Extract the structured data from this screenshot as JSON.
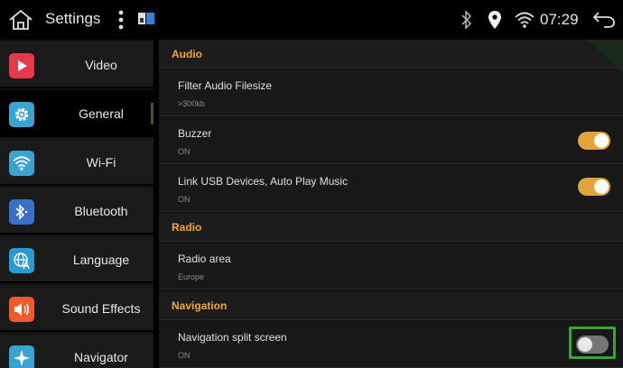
{
  "statusbar": {
    "title": "Settings",
    "time": "07:29"
  },
  "sidebar": {
    "items": [
      {
        "label": "Video",
        "icon": "video-icon",
        "color": "#e8384c",
        "active": false
      },
      {
        "label": "General",
        "icon": "gear-icon",
        "color": "#3aa3d0",
        "active": true
      },
      {
        "label": "Wi-Fi",
        "icon": "wifi-icon",
        "color": "#3aa3d0",
        "active": false
      },
      {
        "label": "Bluetooth",
        "icon": "bluetooth-icon",
        "color": "#3a6fc8",
        "active": false
      },
      {
        "label": "Language",
        "icon": "language-icon",
        "color": "#2a9ad0",
        "active": false
      },
      {
        "label": "Sound Effects",
        "icon": "speaker-icon",
        "color": "#f05a2a",
        "active": false
      },
      {
        "label": "Navigator",
        "icon": "navigator-icon",
        "color": "#3aa3d0",
        "active": false
      }
    ]
  },
  "content": {
    "sections": [
      {
        "title": "Audio"
      },
      {
        "title": "Radio"
      },
      {
        "title": "Navigation"
      }
    ],
    "rows": [
      {
        "title": "Filter Audio Filesize",
        "value": ">300kb"
      },
      {
        "title": "Buzzer",
        "value": "ON",
        "toggle": true
      },
      {
        "title": "Link USB Devices, Auto Play Music",
        "value": "ON",
        "toggle": true
      },
      {
        "title": "Radio area",
        "value": "Europe"
      },
      {
        "title": "Navigation split screen",
        "value": "ON",
        "toggle": false
      }
    ]
  },
  "colors": {
    "accent": "#f0a830",
    "toggle_on": "#e1a33a",
    "toggle_off": "#777777",
    "highlight": "#3ca23c"
  }
}
